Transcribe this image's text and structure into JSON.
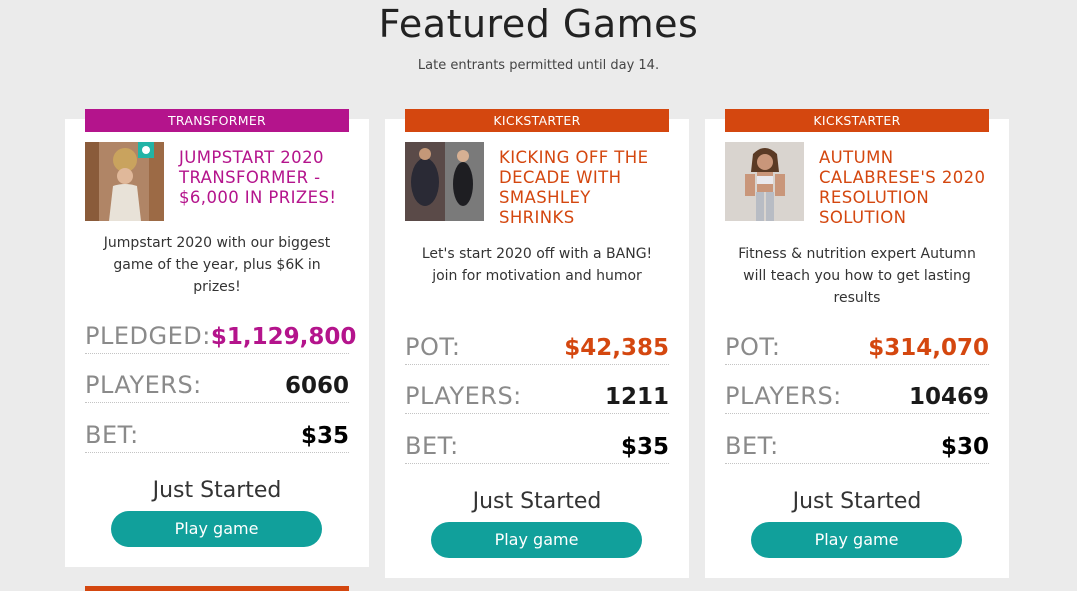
{
  "header": {
    "title": "Featured Games",
    "subtitle": "Late entrants permitted until day 14."
  },
  "colors": {
    "transformer": "#b4148c",
    "kickstarter": "#d4470f",
    "button": "#11a09b"
  },
  "cards": [
    {
      "tag": "TRANSFORMER",
      "title_lines": [
        "JUMPSTART 2020",
        "TRANSFORMER -",
        "$6,000 IN PRIZES!"
      ],
      "desc_lines": [
        "Jumpstart 2020 with our biggest",
        "game of the year, plus $6K in",
        "prizes!"
      ],
      "stats": [
        {
          "label": "PLEDGED:",
          "value": "$1,129,800"
        },
        {
          "label": "PLAYERS:",
          "value": "6060"
        },
        {
          "label": "BET:",
          "value": "$35"
        }
      ],
      "status": "Just Started",
      "button": "Play game"
    },
    {
      "tag": "KICKSTARTER",
      "title_lines": [
        "KICKING OFF THE",
        "DECADE WITH",
        "SMASHLEY",
        "SHRINKS"
      ],
      "desc_lines": [
        "Let's start 2020 off with a BANG!",
        "join for motivation and humor"
      ],
      "stats": [
        {
          "label": "POT:",
          "value": "$42,385"
        },
        {
          "label": "PLAYERS:",
          "value": "1211"
        },
        {
          "label": "BET:",
          "value": "$35"
        }
      ],
      "status": "Just Started",
      "button": "Play game"
    },
    {
      "tag": "KICKSTARTER",
      "title_lines": [
        "AUTUMN",
        "CALABRESE'S 2020",
        "RESOLUTION",
        "SOLUTION"
      ],
      "desc_lines": [
        "Fitness & nutrition expert Autumn",
        "will teach you how to get lasting",
        "results"
      ],
      "stats": [
        {
          "label": "POT:",
          "value": "$314,070"
        },
        {
          "label": "PLAYERS:",
          "value": "10469"
        },
        {
          "label": "BET:",
          "value": "$30"
        }
      ],
      "status": "Just Started",
      "button": "Play game"
    }
  ]
}
